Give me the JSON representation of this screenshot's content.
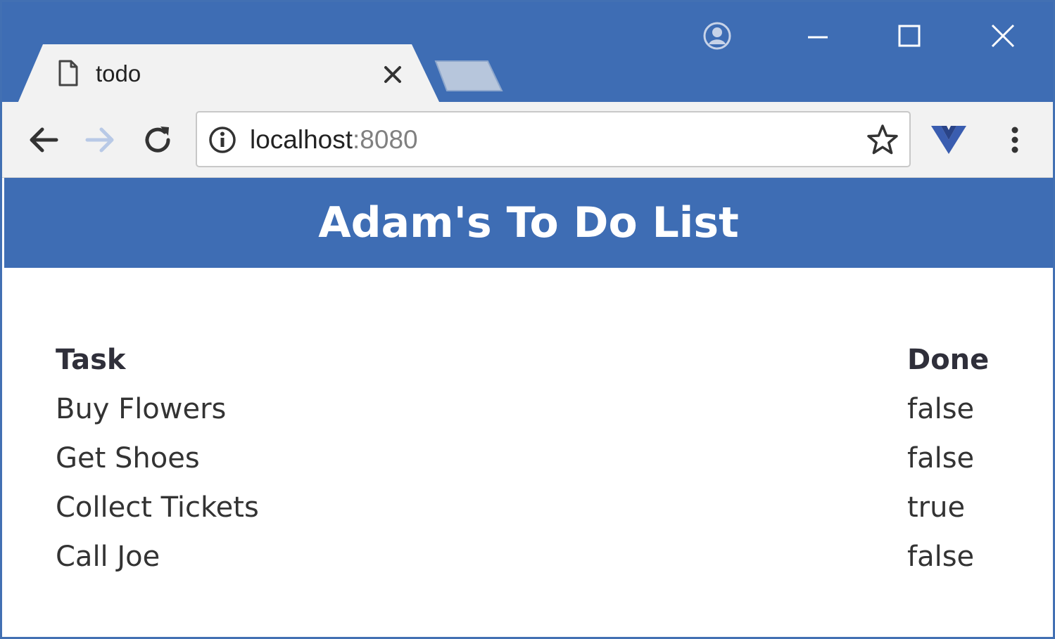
{
  "browser": {
    "tab": {
      "title": "todo"
    },
    "address_bar": {
      "host": "localhost",
      "port": ":8080"
    },
    "colors": {
      "chrome_blue": "#3e6db4",
      "toolbar_gray": "#f2f2f2"
    },
    "icons": {
      "tab_icon": "page-icon",
      "profile": "account-circle-icon",
      "extension": "vue-devtools-icon"
    }
  },
  "page": {
    "title": "Adam's To Do List",
    "table": {
      "headers": {
        "task": "Task",
        "done": "Done"
      },
      "rows": [
        {
          "task": "Buy Flowers",
          "done": "false"
        },
        {
          "task": "Get Shoes",
          "done": "false"
        },
        {
          "task": "Collect Tickets",
          "done": "true"
        },
        {
          "task": "Call Joe",
          "done": "false"
        }
      ]
    }
  }
}
